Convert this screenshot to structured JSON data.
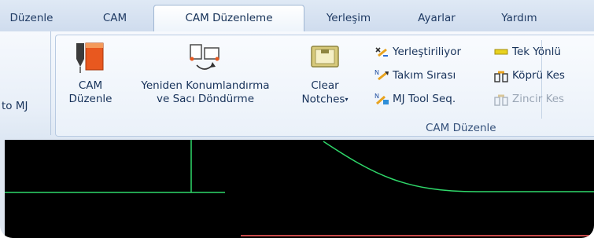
{
  "tabs": [
    {
      "label": "Düzenle",
      "active": false
    },
    {
      "label": "CAM",
      "active": false
    },
    {
      "label": "CAM Düzenleme",
      "active": true
    },
    {
      "label": "Yerleşim",
      "active": false
    },
    {
      "label": "Ayarlar",
      "active": false
    },
    {
      "label": "Yardım",
      "active": false
    }
  ],
  "left_panel": {
    "label": "to MJ"
  },
  "group": {
    "label": "CAM Düzenle",
    "cam_edit": {
      "line1": "CAM",
      "line2": "Düzenle"
    },
    "reposition": {
      "line1": "Yeniden Konumlandırma",
      "line2": "ve Sacı Döndürme"
    },
    "clear_notches": {
      "line1": "Clear",
      "line2": "Notches"
    },
    "small_buttons": [
      {
        "label": "Yerleştiriliyor",
        "icon": "placing-icon",
        "enabled": true
      },
      {
        "label": "Takım Sırası",
        "icon": "tool-order-icon",
        "enabled": true
      },
      {
        "label": "MJ Tool Seq.",
        "icon": "mj-tool-seq-icon",
        "enabled": true
      },
      {
        "label": "Tek Yönlü",
        "icon": "one-way-icon",
        "enabled": true
      },
      {
        "label": "Köprü Kes",
        "icon": "bridge-cut-icon",
        "enabled": true
      },
      {
        "label": "Zincir Kes",
        "icon": "chain-cut-icon",
        "enabled": false
      }
    ]
  },
  "colors": {
    "accent": "#e8581f",
    "canvas_bg": "#000000",
    "geometry": "#2fd86a"
  }
}
